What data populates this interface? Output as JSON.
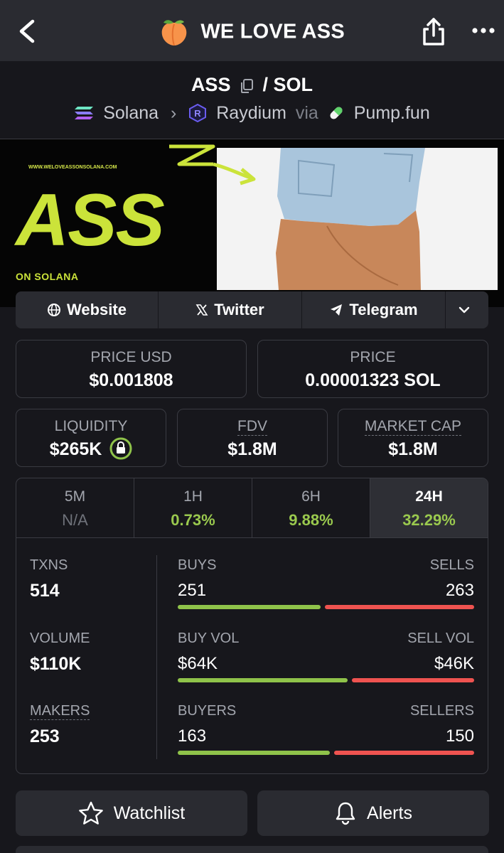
{
  "header": {
    "title": "WE LOVE ASS",
    "icons": {
      "back": "chevron-left-icon",
      "logo": "peach-icon",
      "share": "share-icon",
      "more": "more-icon"
    }
  },
  "pair": {
    "base": "ASS",
    "separator": "/",
    "quote": "SOL"
  },
  "route": {
    "chain": "Solana",
    "dex": "Raydium",
    "via": "via",
    "launchpad": "Pump.fun"
  },
  "banner": {
    "url": "WWW.WELOVEASSONSOLANA.COM",
    "headline": "ASS",
    "subline": "ON SOLANA"
  },
  "links": {
    "website": "Website",
    "twitter": "Twitter",
    "telegram": "Telegram"
  },
  "prices": {
    "price_usd_label": "PRICE USD",
    "price_usd": "$0.001808",
    "price_label": "PRICE",
    "price_native": "0.00001323 SOL"
  },
  "metrics": {
    "liquidity_label": "LIQUIDITY",
    "liquidity": "$265K",
    "fdv_label": "FDV",
    "fdv": "$1.8M",
    "mcap_label": "MARKET CAP",
    "mcap": "$1.8M"
  },
  "timeframes": [
    {
      "label": "5M",
      "change": "N/A"
    },
    {
      "label": "1H",
      "change": "0.73%"
    },
    {
      "label": "6H",
      "change": "9.88%"
    },
    {
      "label": "24H",
      "change": "32.29%"
    }
  ],
  "stats": {
    "txns_label": "TXNS",
    "txns": "514",
    "volume_label": "VOLUME",
    "volume": "$110K",
    "makers_label": "MAKERS",
    "makers": "253",
    "buys_label": "BUYS",
    "buys": "251",
    "sells_label": "SELLS",
    "sells": "263",
    "buy_vol_label": "BUY VOL",
    "buy_vol": "$64K",
    "sell_vol_label": "SELL VOL",
    "sell_vol": "$46K",
    "buyers_label": "BUYERS",
    "buyers": "163",
    "sellers_label": "SELLERS",
    "sellers": "150",
    "buys_fraction": 0.488,
    "buy_vol_fraction": 0.582,
    "buyers_fraction": 0.521
  },
  "actions": {
    "watchlist": "Watchlist",
    "alerts": "Alerts"
  },
  "colors": {
    "background": "#17171c",
    "panel": "#2a2b31",
    "positive": "#9ac94e",
    "buy_bar": "#8fc34a",
    "sell_bar": "#ef5350",
    "banner_accent": "#cbe33a"
  }
}
